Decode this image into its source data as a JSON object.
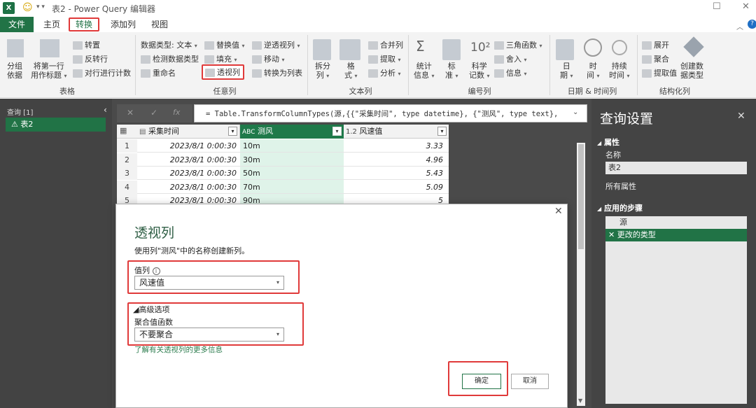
{
  "window": {
    "title": "表2 - Power Query 编辑器",
    "app_icon": "X"
  },
  "menu": {
    "file": "文件",
    "home": "主页",
    "transform": "转换",
    "add_column": "添加列",
    "view": "视图"
  },
  "ribbon": {
    "table": {
      "group_by_line1": "分组",
      "group_by_line2": "依据",
      "first_row_line1": "将第一行",
      "first_row_line2": "用作标题",
      "transpose": "转置",
      "reverse_rows": "反转行",
      "count_rows": "对行进行计数",
      "label": "表格"
    },
    "any_column": {
      "data_type": "数据类型: 文本",
      "detect_type": "检测数据类型",
      "rename": "重命名",
      "replace_values": "替换值",
      "fill": "填充",
      "pivot_column": "透视列",
      "unpivot_columns": "逆透视列",
      "move": "移动",
      "convert_to_list": "转换为列表",
      "label": "任意列"
    },
    "text_column": {
      "split_line1": "拆分",
      "split_line2": "列",
      "format_line1": "格",
      "format_line2": "式",
      "merge_columns": "合并列",
      "extract": "提取",
      "parse": "分析",
      "label": "文本列"
    },
    "number_column": {
      "statistics_line1": "统计",
      "statistics_line2": "信息",
      "standard_line1": "标",
      "standard_line2": "准",
      "scientific_line1": "科学",
      "scientific_line2": "记数",
      "trig": "三角函数",
      "rounding": "舍入",
      "information": "信息",
      "label": "编号列"
    },
    "datetime_column": {
      "date_line1": "日",
      "date_line2": "期",
      "time_line1": "时",
      "time_line2": "间",
      "duration_line1": "持续",
      "duration_line2": "时间",
      "label": "日期 & 时间列"
    },
    "structured_column": {
      "expand": "展开",
      "aggregate": "聚合",
      "extract_values": "提取值",
      "create_type_line1": "创建数",
      "create_type_line2": "据类型",
      "label": "结构化列"
    }
  },
  "queries": {
    "header": "查询 [1]",
    "items": [
      "表2"
    ]
  },
  "formula_bar": {
    "cancel": "✕",
    "commit": "✓",
    "fx": "fx",
    "formula": "= Table.TransformColumnTypes(源,{{\"采集时间\", type datetime}, {\"测风\", type text}, {\"风"
  },
  "grid": {
    "columns": [
      {
        "type": "日期",
        "name": "采集时间"
      },
      {
        "type": "ABC",
        "name": "测风"
      },
      {
        "type": "1.2",
        "name": "风速值"
      }
    ],
    "rows": [
      {
        "num": "1",
        "time": "2023/8/1 0:00:30",
        "wind": "10m",
        "speed": "3.33"
      },
      {
        "num": "2",
        "time": "2023/8/1 0:00:30",
        "wind": "30m",
        "speed": "4.96"
      },
      {
        "num": "3",
        "time": "2023/8/1 0:00:30",
        "wind": "50m",
        "speed": "5.43"
      },
      {
        "num": "4",
        "time": "2023/8/1 0:00:30",
        "wind": "70m",
        "speed": "5.09"
      },
      {
        "num": "5",
        "time": "2023/8/1 0:00:30",
        "wind": "90m",
        "speed": "5"
      }
    ]
  },
  "query_settings": {
    "title": "查询设置",
    "properties": "属性",
    "name_label": "名称",
    "name_value": "表2",
    "all_properties": "所有属性",
    "applied_steps": "应用的步骤",
    "steps": [
      "源",
      "更改的类型"
    ]
  },
  "dialog": {
    "title": "透视列",
    "description": "使用列\"测风\"中的名称创建新列。",
    "values_label": "值列",
    "values_selected": "风速值",
    "advanced_label": "◢高级选项",
    "agg_label": "聚合值函数",
    "agg_selected": "不要聚合",
    "learn_more": "了解有关透视列的更多信息",
    "ok": "确定",
    "cancel": "取消"
  },
  "colors": {
    "excel_green": "#217346",
    "highlight_red": "#e03a3a",
    "selected_column": "#dff3e9",
    "dark_pane": "#444444"
  }
}
